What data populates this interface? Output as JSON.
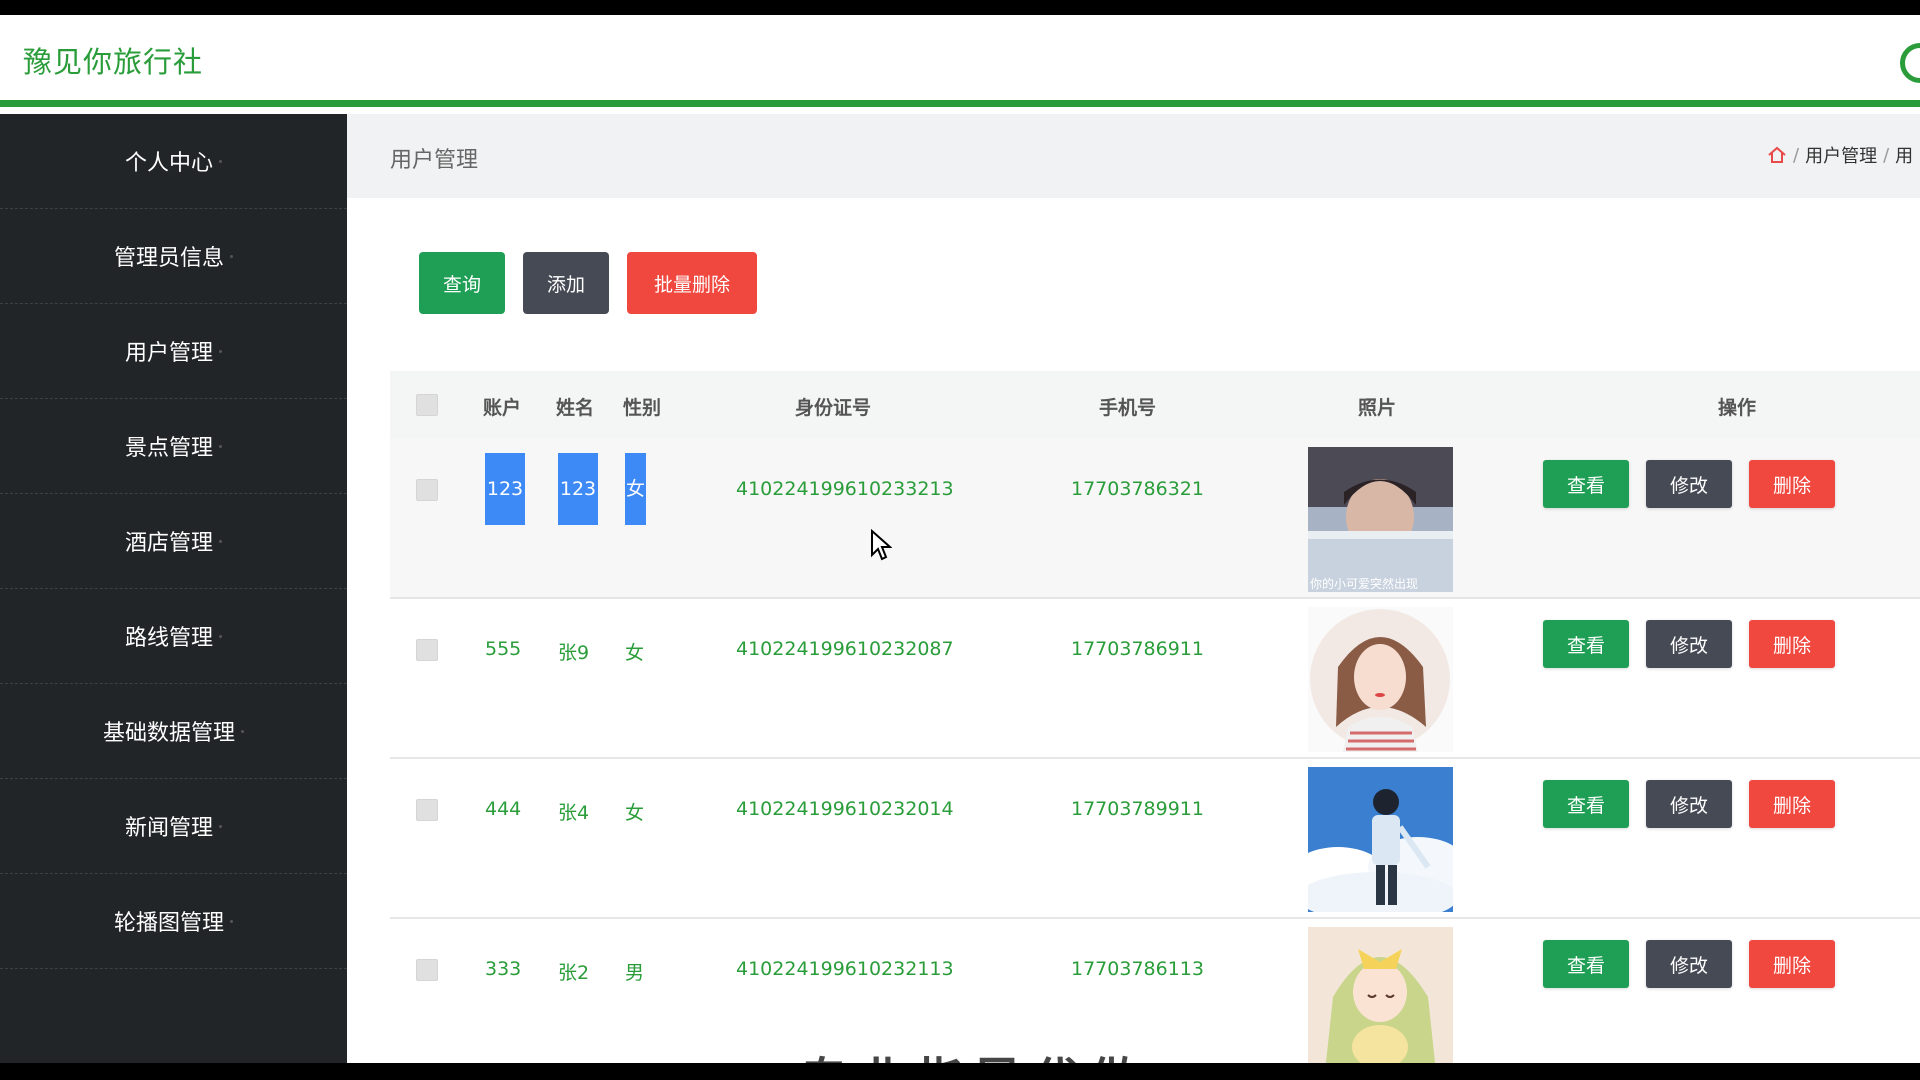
{
  "header": {
    "brand": "豫见你旅行社"
  },
  "sidebar": {
    "items": [
      {
        "label": "个人中心"
      },
      {
        "label": "管理员信息"
      },
      {
        "label": "用户管理"
      },
      {
        "label": "景点管理"
      },
      {
        "label": "酒店管理"
      },
      {
        "label": "路线管理"
      },
      {
        "label": "基础数据管理"
      },
      {
        "label": "新闻管理"
      },
      {
        "label": "轮播图管理"
      }
    ]
  },
  "page": {
    "title": "用户管理",
    "breadcrumb": [
      "用户管理",
      "用"
    ]
  },
  "toolbar": {
    "search_label": "查询",
    "add_label": "添加",
    "batch_delete_label": "批量删除"
  },
  "table": {
    "columns": [
      "账户",
      "姓名",
      "性别",
      "身份证号",
      "手机号",
      "照片",
      "操作"
    ],
    "rows": [
      {
        "account": "123",
        "name": "123",
        "gender": "女",
        "id_number": "410224199610233213",
        "phone": "17703786321",
        "photo_caption": "你的小可爱突然出现"
      },
      {
        "account": "555",
        "name": "张9",
        "gender": "女",
        "id_number": "410224199610232087",
        "phone": "17703786911"
      },
      {
        "account": "444",
        "name": "张4",
        "gender": "女",
        "id_number": "410224199610232014",
        "phone": "17703789911"
      },
      {
        "account": "333",
        "name": "张2",
        "gender": "男",
        "id_number": "410224199610232113",
        "phone": "17703786113"
      }
    ],
    "actions": {
      "view": "查看",
      "edit": "修改",
      "delete": "删除"
    }
  },
  "overlay": {
    "watermark": "专业指导代做"
  },
  "colors": {
    "brand": "#2a9d3a",
    "sidebar": "#222527",
    "danger": "#f0473e",
    "secondary": "#454a55",
    "primary": "#1f9f55",
    "selection": "#3d8af7"
  }
}
